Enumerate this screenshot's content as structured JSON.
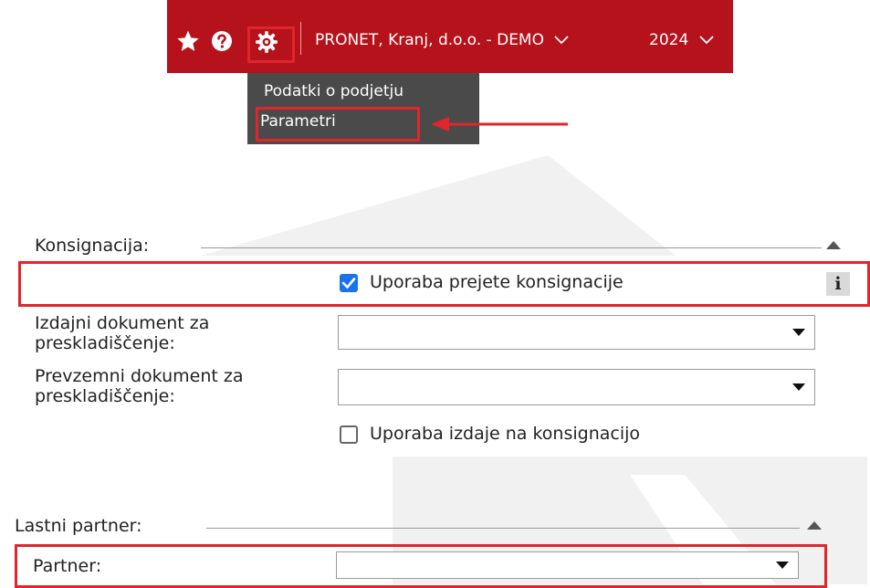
{
  "topbar": {
    "company": "PRONET, Kranj, d.o.o. - DEMO",
    "year": "2024",
    "bg_color": "#b6121b"
  },
  "settings_menu": {
    "items": [
      {
        "label": "Podatki o podjetju"
      },
      {
        "label": "Parametri"
      }
    ]
  },
  "konsignacija": {
    "title": "Konsignacija:",
    "use_received_label": "Uporaba prejete konsignacije",
    "use_received_checked": true,
    "info_label": "i",
    "issue_doc_label_1": "Izdajni dokument za",
    "issue_doc_label_2": "preskladiščenje:",
    "receipt_doc_label_1": "Prevzemni dokument za",
    "receipt_doc_label_2": "preskladiščenje:",
    "use_issue_label": "Uporaba izdaje na konsignacijo",
    "use_issue_checked": false
  },
  "lastni_partner": {
    "title": "Lastni partner:",
    "partner_label": "Partner:"
  },
  "colors": {
    "highlight": "#e0252d",
    "checkbox_on": "#1a73e8",
    "menu_bg": "#4a4a4a"
  }
}
